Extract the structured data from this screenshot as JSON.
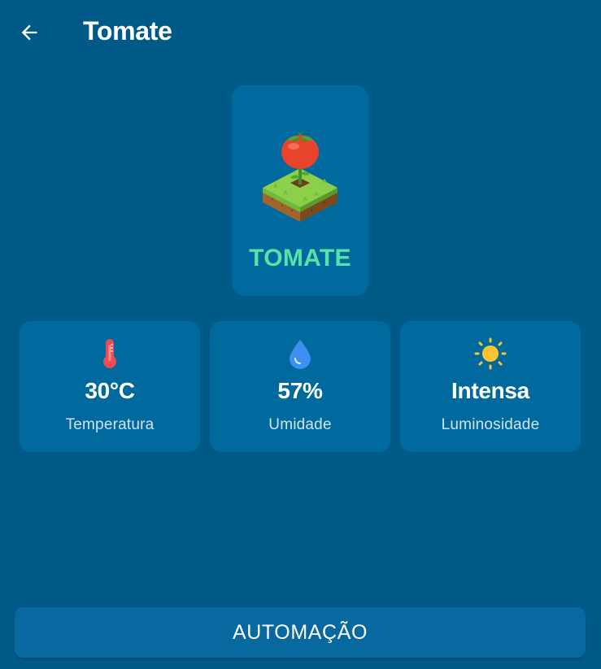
{
  "header": {
    "back_icon": "arrow-left-icon",
    "title": "Tomate"
  },
  "plant": {
    "name": "TOMATE",
    "image": "tomato-plant-illustration",
    "name_color": "#57e3a8"
  },
  "stats": [
    {
      "icon": "thermometer-icon",
      "value": "30°C",
      "label": "Temperatura"
    },
    {
      "icon": "water-drop-icon",
      "value": "57%",
      "label": "Umidade"
    },
    {
      "icon": "sun-icon",
      "value": "Intensa",
      "label": "Luminosidade"
    }
  ],
  "actions": {
    "automation_label": "AUTOMAÇÃO"
  },
  "colors": {
    "background": "#005a88",
    "card": "#006a9e",
    "button": "#0868a0",
    "accent_green": "#57e3a8",
    "thermometer_red": "#ef4b55",
    "drop_blue": "#3d8ff2",
    "sun_yellow": "#fbc531"
  }
}
